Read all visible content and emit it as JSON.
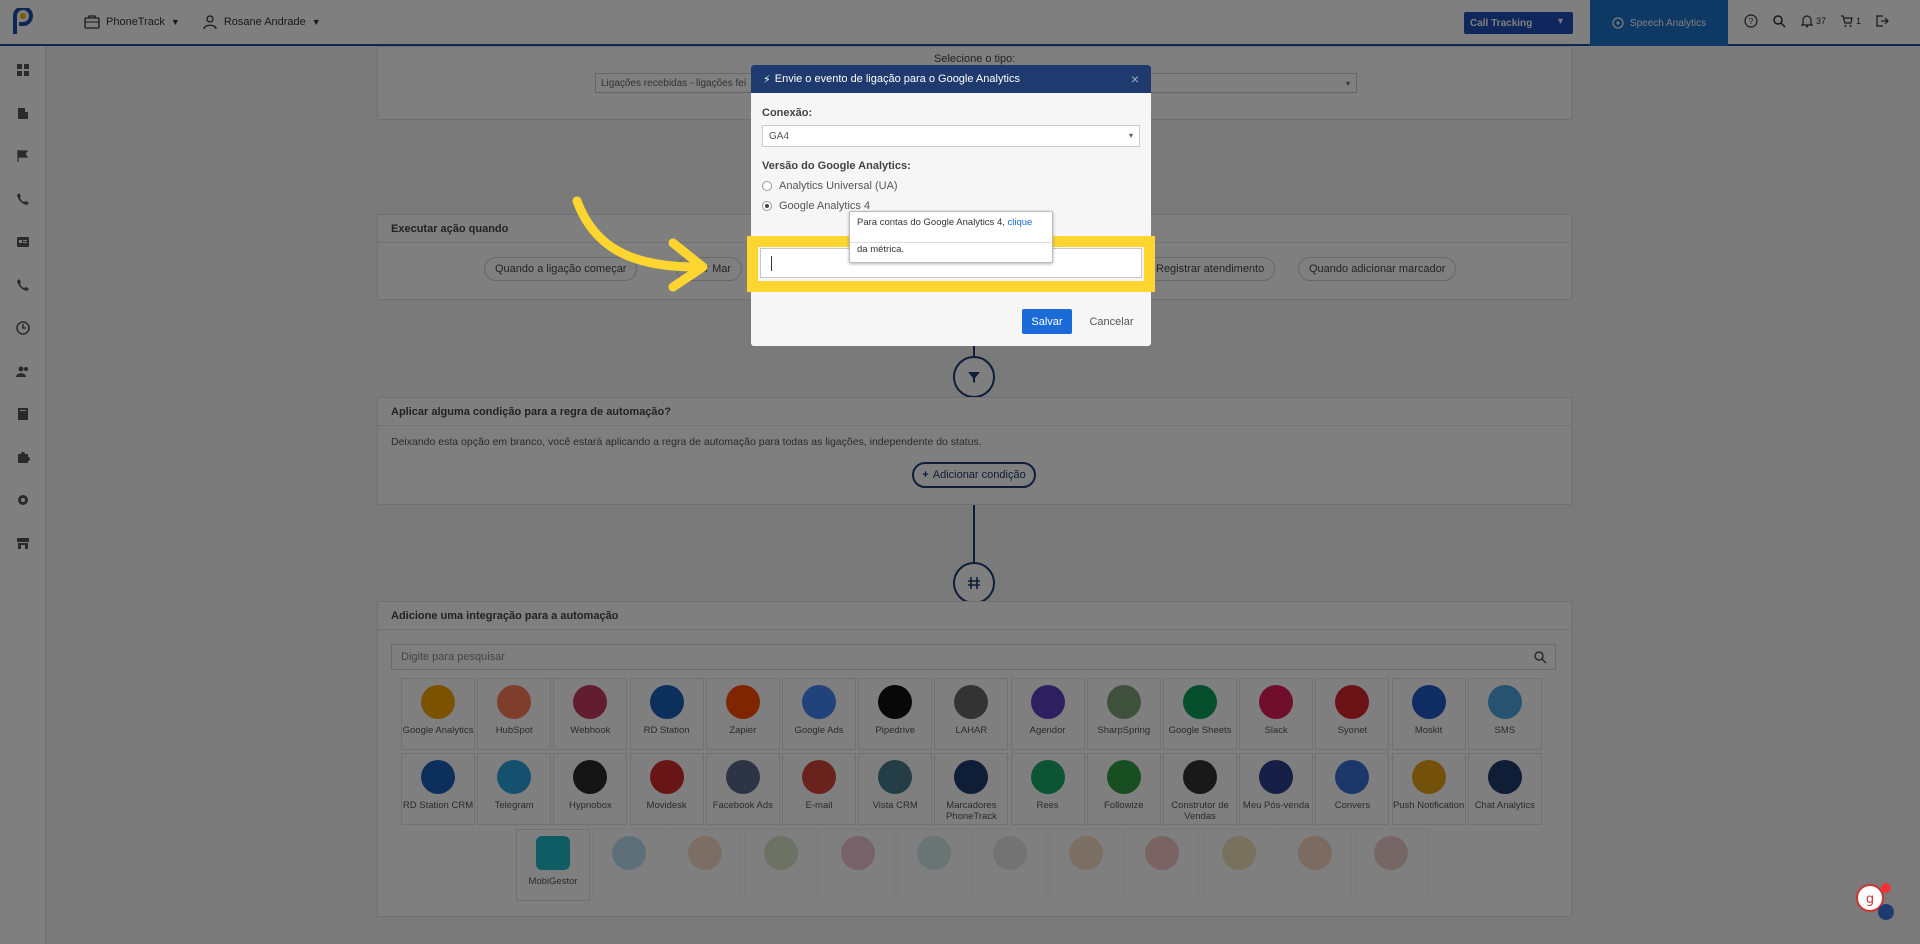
{
  "topbar": {
    "product_menu": "PhoneTrack",
    "user_menu": "Rosane Andrade",
    "call_tracking_label": "Call Tracking",
    "speech_analytics_label": "Speech Analytics",
    "notifications_count": "37",
    "cart_count": "1"
  },
  "top_panel": {
    "select_type_label": "Selecione o tipo:",
    "select_type_value": "Ligações recebidas - ligações fei"
  },
  "trigger_panel": {
    "title": "Executar ação quando",
    "chips": [
      "Quando a ligação começar",
      "onar Mar",
      "Registrar atendimento",
      "Quando adicionar marcador"
    ]
  },
  "condition_panel": {
    "title": "Aplicar alguma condição para a regra de automação?",
    "description": "Deixando esta opção em branco, você estará aplicando a regra de automação para todas as ligações, independente do status.",
    "add_button": "Adicionar condição"
  },
  "integration_panel": {
    "title": "Adicione uma integração para a automação",
    "search_placeholder": "Digite para pesquisar",
    "row1": [
      {
        "name": "Google Analytics",
        "color": "#f4a400"
      },
      {
        "name": "HubSpot",
        "color": "#ff7a59"
      },
      {
        "name": "Webhook",
        "color": "#c73a63"
      },
      {
        "name": "RD Station",
        "color": "#1a5eb8"
      },
      {
        "name": "Zapier",
        "color": "#ff4a00"
      },
      {
        "name": "Google Ads",
        "color": "#4285f4"
      },
      {
        "name": "Pipedrive",
        "color": "#111111"
      },
      {
        "name": "LAHAR",
        "color": "#666666"
      },
      {
        "name": "Agendor",
        "color": "#5a3fc0"
      },
      {
        "name": "SharpSpring",
        "color": "#7fa37a"
      },
      {
        "name": "Google Sheets",
        "color": "#0f9d58"
      },
      {
        "name": "Slack",
        "color": "#e01e5a"
      },
      {
        "name": "Syonet",
        "color": "#d7262d"
      },
      {
        "name": "Moskit",
        "color": "#1e5bc6"
      },
      {
        "name": "SMS",
        "color": "#4fa6e0"
      }
    ],
    "row2": [
      {
        "name": "RD Station CRM",
        "color": "#1a5eb8"
      },
      {
        "name": "Telegram",
        "color": "#2aa3de"
      },
      {
        "name": "Hypnobox",
        "color": "#2b2b2b"
      },
      {
        "name": "Movidesk",
        "color": "#d52b2b"
      },
      {
        "name": "Facebook Ads",
        "color": "#5a6b8a"
      },
      {
        "name": "E-mail",
        "color": "#d44638"
      },
      {
        "name": "Vista CRM",
        "color": "#4b7a8c"
      },
      {
        "name": "Marcadores PhoneTrack",
        "color": "#1f3a6e"
      },
      {
        "name": "Rees",
        "color": "#1aa86a"
      },
      {
        "name": "Followize",
        "color": "#2f9e44"
      },
      {
        "name": "Construtor de Vendas",
        "color": "#333333"
      },
      {
        "name": "Meu Pós-venda",
        "color": "#2c3e8c"
      },
      {
        "name": "Convers",
        "color": "#3b6fd6"
      },
      {
        "name": "Push Notification",
        "color": "#e8a317"
      },
      {
        "name": "Chat Analytics",
        "color": "#1f3a6e"
      }
    ],
    "row3": [
      {
        "name": "MobiGestor",
        "color": "#1eb8c9"
      }
    ]
  },
  "modal": {
    "title": "Envie o evento de ligação para o Google Analytics",
    "connection_label": "Conexão:",
    "connection_value": "GA4",
    "version_label": "Versão do Google Analytics:",
    "option_ua": "Analytics Universal (UA)",
    "option_ga4": "Google Analytics 4",
    "save_label": "Salvar",
    "cancel_label": "Cancelar"
  },
  "tooltip": {
    "text_before": "Para contas do Google Analytics 4,",
    "link": "clique",
    "text_after": "da métrica."
  },
  "colors": {
    "accent": "#1f3a6e",
    "highlight": "#ffd630",
    "primary_button": "#1a6bd8"
  }
}
